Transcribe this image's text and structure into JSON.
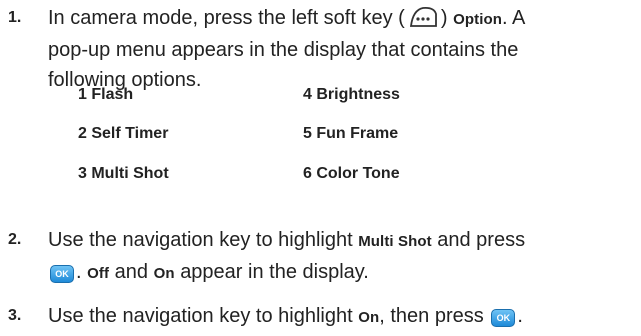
{
  "steps": [
    {
      "num": "1.",
      "line1_a": "In camera mode, press the left soft key (",
      "line1_b": ")",
      "line1_bold": "Option",
      "line1_c": ". A",
      "line2": "pop-up menu appears in the display that contains the",
      "line3": "following options."
    },
    {
      "num": "2.",
      "line1_a": "Use the navigation key to highlight",
      "line1_bold": "Multi Shot",
      "line1_b": "and press",
      "line2_bold1": "Off",
      "line2_a": "and",
      "line2_bold2": "On",
      "line2_b": "appear in the display."
    },
    {
      "num": "3.",
      "line1_a": "Use the navigation key to highlight",
      "line1_bold": "On",
      "line1_b": ", then press",
      "line1_c": "."
    }
  ],
  "options": [
    "1 Flash",
    "2 Self Timer",
    "3 Multi Shot",
    "4 Brightness",
    "5 Fun Frame",
    "6 Color Tone"
  ],
  "ok_key_label": "OK",
  "icons": {
    "soft_key": "left-soft-key-icon",
    "ok_key": "ok-key-icon"
  },
  "colors": {
    "ok_key": "#2a96e0",
    "text": "#222222"
  }
}
